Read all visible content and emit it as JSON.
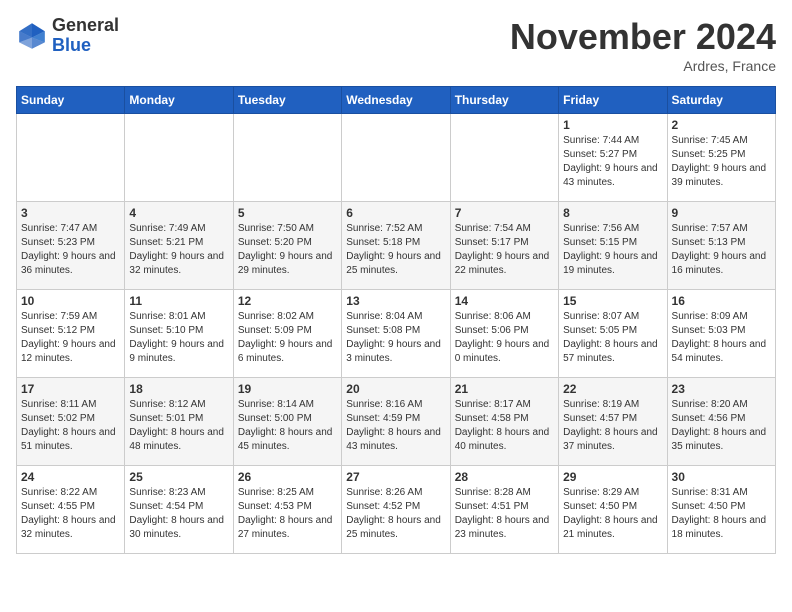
{
  "header": {
    "logo_general": "General",
    "logo_blue": "Blue",
    "month_title": "November 2024",
    "location": "Ardres, France"
  },
  "days_of_week": [
    "Sunday",
    "Monday",
    "Tuesday",
    "Wednesday",
    "Thursday",
    "Friday",
    "Saturday"
  ],
  "weeks": [
    [
      {
        "day": "",
        "info": ""
      },
      {
        "day": "",
        "info": ""
      },
      {
        "day": "",
        "info": ""
      },
      {
        "day": "",
        "info": ""
      },
      {
        "day": "",
        "info": ""
      },
      {
        "day": "1",
        "info": "Sunrise: 7:44 AM\nSunset: 5:27 PM\nDaylight: 9 hours and 43 minutes."
      },
      {
        "day": "2",
        "info": "Sunrise: 7:45 AM\nSunset: 5:25 PM\nDaylight: 9 hours and 39 minutes."
      }
    ],
    [
      {
        "day": "3",
        "info": "Sunrise: 7:47 AM\nSunset: 5:23 PM\nDaylight: 9 hours and 36 minutes."
      },
      {
        "day": "4",
        "info": "Sunrise: 7:49 AM\nSunset: 5:21 PM\nDaylight: 9 hours and 32 minutes."
      },
      {
        "day": "5",
        "info": "Sunrise: 7:50 AM\nSunset: 5:20 PM\nDaylight: 9 hours and 29 minutes."
      },
      {
        "day": "6",
        "info": "Sunrise: 7:52 AM\nSunset: 5:18 PM\nDaylight: 9 hours and 25 minutes."
      },
      {
        "day": "7",
        "info": "Sunrise: 7:54 AM\nSunset: 5:17 PM\nDaylight: 9 hours and 22 minutes."
      },
      {
        "day": "8",
        "info": "Sunrise: 7:56 AM\nSunset: 5:15 PM\nDaylight: 9 hours and 19 minutes."
      },
      {
        "day": "9",
        "info": "Sunrise: 7:57 AM\nSunset: 5:13 PM\nDaylight: 9 hours and 16 minutes."
      }
    ],
    [
      {
        "day": "10",
        "info": "Sunrise: 7:59 AM\nSunset: 5:12 PM\nDaylight: 9 hours and 12 minutes."
      },
      {
        "day": "11",
        "info": "Sunrise: 8:01 AM\nSunset: 5:10 PM\nDaylight: 9 hours and 9 minutes."
      },
      {
        "day": "12",
        "info": "Sunrise: 8:02 AM\nSunset: 5:09 PM\nDaylight: 9 hours and 6 minutes."
      },
      {
        "day": "13",
        "info": "Sunrise: 8:04 AM\nSunset: 5:08 PM\nDaylight: 9 hours and 3 minutes."
      },
      {
        "day": "14",
        "info": "Sunrise: 8:06 AM\nSunset: 5:06 PM\nDaylight: 9 hours and 0 minutes."
      },
      {
        "day": "15",
        "info": "Sunrise: 8:07 AM\nSunset: 5:05 PM\nDaylight: 8 hours and 57 minutes."
      },
      {
        "day": "16",
        "info": "Sunrise: 8:09 AM\nSunset: 5:03 PM\nDaylight: 8 hours and 54 minutes."
      }
    ],
    [
      {
        "day": "17",
        "info": "Sunrise: 8:11 AM\nSunset: 5:02 PM\nDaylight: 8 hours and 51 minutes."
      },
      {
        "day": "18",
        "info": "Sunrise: 8:12 AM\nSunset: 5:01 PM\nDaylight: 8 hours and 48 minutes."
      },
      {
        "day": "19",
        "info": "Sunrise: 8:14 AM\nSunset: 5:00 PM\nDaylight: 8 hours and 45 minutes."
      },
      {
        "day": "20",
        "info": "Sunrise: 8:16 AM\nSunset: 4:59 PM\nDaylight: 8 hours and 43 minutes."
      },
      {
        "day": "21",
        "info": "Sunrise: 8:17 AM\nSunset: 4:58 PM\nDaylight: 8 hours and 40 minutes."
      },
      {
        "day": "22",
        "info": "Sunrise: 8:19 AM\nSunset: 4:57 PM\nDaylight: 8 hours and 37 minutes."
      },
      {
        "day": "23",
        "info": "Sunrise: 8:20 AM\nSunset: 4:56 PM\nDaylight: 8 hours and 35 minutes."
      }
    ],
    [
      {
        "day": "24",
        "info": "Sunrise: 8:22 AM\nSunset: 4:55 PM\nDaylight: 8 hours and 32 minutes."
      },
      {
        "day": "25",
        "info": "Sunrise: 8:23 AM\nSunset: 4:54 PM\nDaylight: 8 hours and 30 minutes."
      },
      {
        "day": "26",
        "info": "Sunrise: 8:25 AM\nSunset: 4:53 PM\nDaylight: 8 hours and 27 minutes."
      },
      {
        "day": "27",
        "info": "Sunrise: 8:26 AM\nSunset: 4:52 PM\nDaylight: 8 hours and 25 minutes."
      },
      {
        "day": "28",
        "info": "Sunrise: 8:28 AM\nSunset: 4:51 PM\nDaylight: 8 hours and 23 minutes."
      },
      {
        "day": "29",
        "info": "Sunrise: 8:29 AM\nSunset: 4:50 PM\nDaylight: 8 hours and 21 minutes."
      },
      {
        "day": "30",
        "info": "Sunrise: 8:31 AM\nSunset: 4:50 PM\nDaylight: 8 hours and 18 minutes."
      }
    ]
  ]
}
